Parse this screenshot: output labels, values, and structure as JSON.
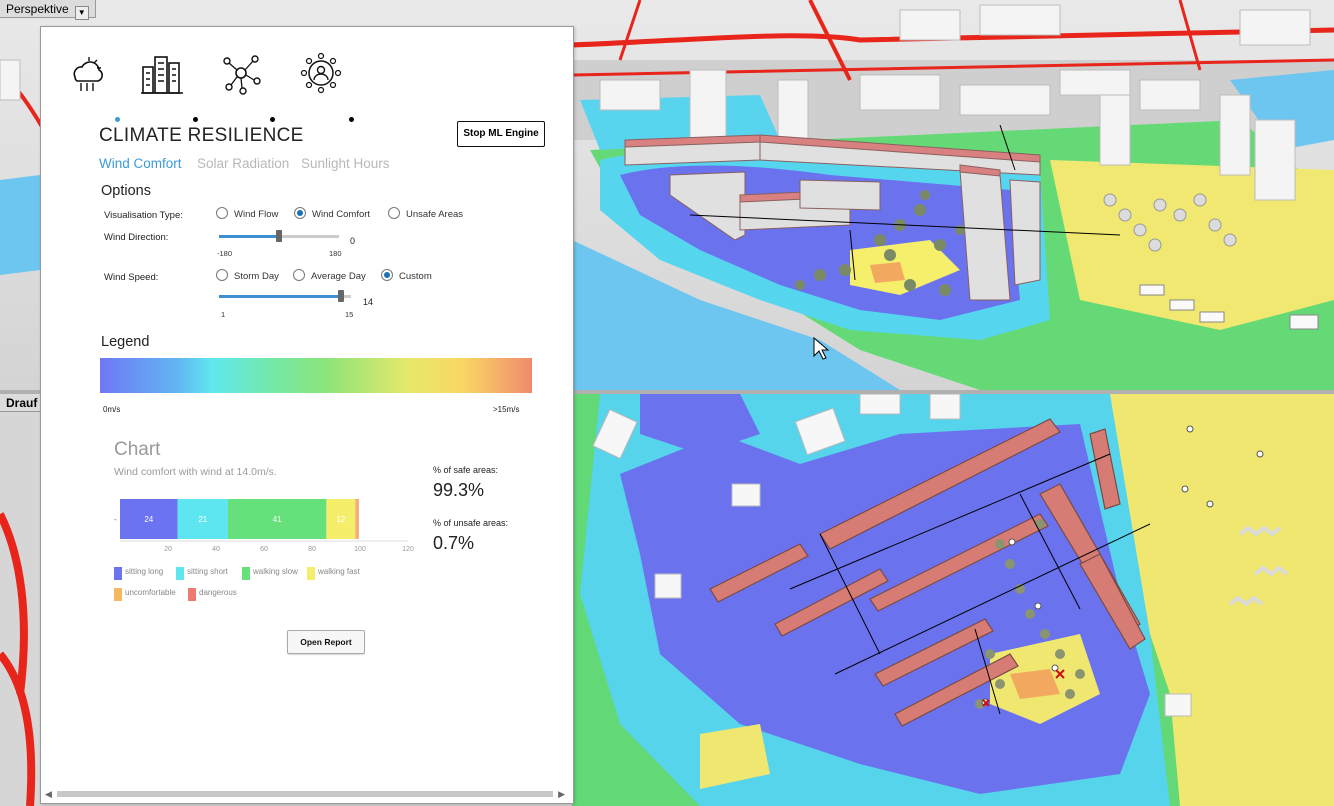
{
  "viewports": {
    "top_label": "Perspektive",
    "bottom_label": "Drauf"
  },
  "panel": {
    "tab_icons": [
      "weather-cloud-icon",
      "city-buildings-icon",
      "network-nodes-icon",
      "people-network-icon"
    ],
    "title": "CLIMATE RESILIENCE",
    "stop_button": "Stop ML Engine",
    "subtabs": [
      "Wind Comfort",
      "Solar Radiation",
      "Sunlight Hours"
    ],
    "options_heading": "Options",
    "visualisation": {
      "label": "Visualisation Type:",
      "options": [
        "Wind Flow",
        "Wind Comfort",
        "Unsafe Areas"
      ],
      "selected": "Wind Comfort"
    },
    "wind_direction": {
      "label": "Wind Direction:",
      "min": "-180",
      "max": "180",
      "value": "0"
    },
    "wind_speed": {
      "label": "Wind Speed:",
      "options": [
        "Storm Day",
        "Average Day",
        "Custom"
      ],
      "selected": "Custom",
      "min": "1",
      "max": "15",
      "value": "14"
    },
    "legend": {
      "heading": "Legend",
      "min_label": "0m/s",
      "max_label": ">15m/s"
    },
    "chart": {
      "heading": "Chart",
      "subtitle": "Wind comfort with wind at 14.0m/s.",
      "safe_label": "% of safe areas:",
      "safe_value": "99.3%",
      "unsafe_label": "% of unsafe areas:",
      "unsafe_value": "0.7%",
      "legend_items": [
        {
          "label": "sitting long",
          "color": "#6b73f0"
        },
        {
          "label": "sitting short",
          "color": "#5ee6f0"
        },
        {
          "label": "walking slow",
          "color": "#66e07a"
        },
        {
          "label": "walking fast",
          "color": "#f4ee6a"
        },
        {
          "label": "uncomfortable",
          "color": "#f7b860"
        },
        {
          "label": "dangerous",
          "color": "#ee7b72"
        }
      ]
    },
    "open_report": "Open Report"
  },
  "chart_data": {
    "type": "bar",
    "orientation": "horizontal-stacked",
    "categories": [
      "-"
    ],
    "series": [
      {
        "name": "sitting long",
        "values": [
          24
        ],
        "color": "#6b73f0"
      },
      {
        "name": "sitting short",
        "values": [
          21
        ],
        "color": "#5ee6f0"
      },
      {
        "name": "walking slow",
        "values": [
          41
        ],
        "color": "#66e07a"
      },
      {
        "name": "walking fast",
        "values": [
          12
        ],
        "color": "#f4ee6a"
      },
      {
        "name": "uncomfortable",
        "values": [
          1
        ],
        "color": "#f7b860"
      },
      {
        "name": "dangerous",
        "values": [
          0.3
        ],
        "color": "#ee7b72"
      }
    ],
    "xticks": [
      "20",
      "40",
      "60",
      "80",
      "100",
      "120"
    ],
    "xlim": [
      0,
      120
    ],
    "title": "Chart",
    "subtitle": "Wind comfort with wind at 14.0m/s."
  }
}
